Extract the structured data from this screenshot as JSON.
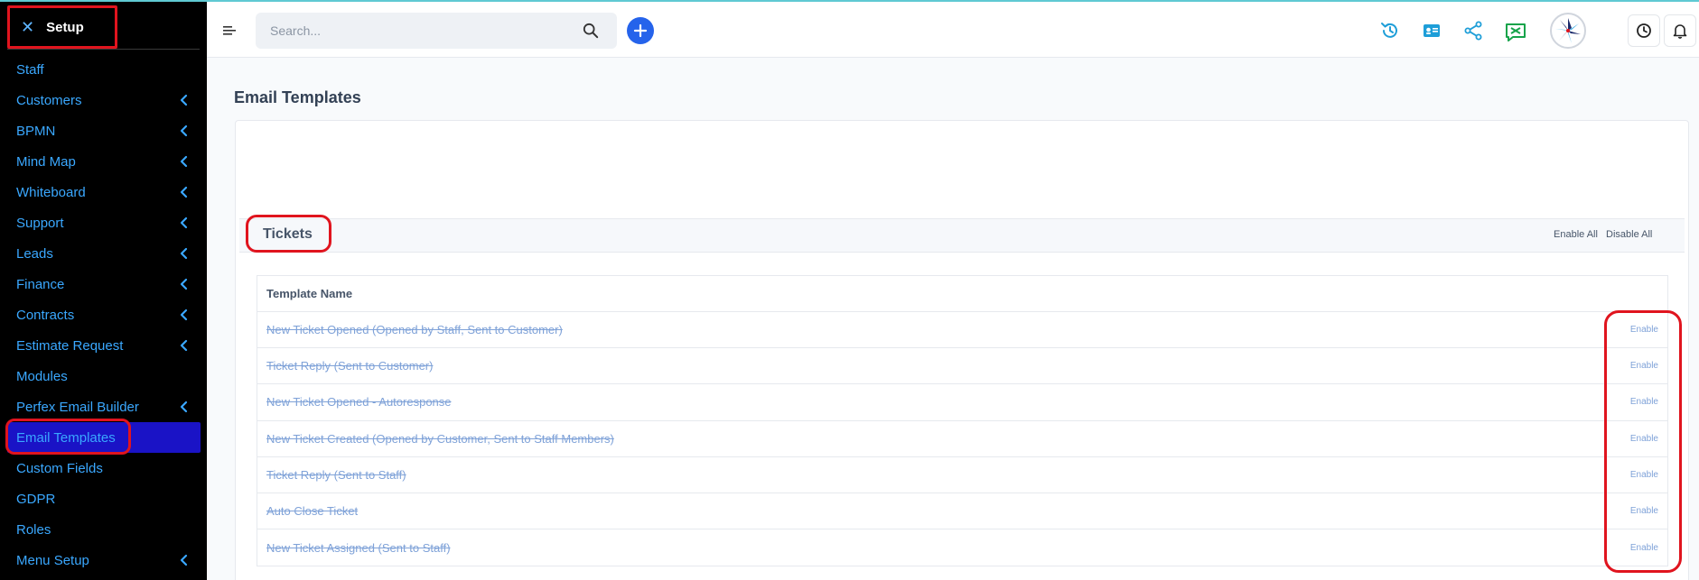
{
  "sidebar": {
    "header": "Setup",
    "items": [
      {
        "label": "Staff",
        "chevron": false
      },
      {
        "label": "Customers",
        "chevron": true
      },
      {
        "label": "BPMN",
        "chevron": true
      },
      {
        "label": "Mind Map",
        "chevron": true
      },
      {
        "label": "Whiteboard",
        "chevron": true
      },
      {
        "label": "Support",
        "chevron": true
      },
      {
        "label": "Leads",
        "chevron": true
      },
      {
        "label": "Finance",
        "chevron": true
      },
      {
        "label": "Contracts",
        "chevron": true
      },
      {
        "label": "Estimate Request",
        "chevron": true
      },
      {
        "label": "Modules",
        "chevron": false
      },
      {
        "label": "Perfex Email Builder",
        "chevron": true
      },
      {
        "label": "Email Templates",
        "chevron": false,
        "active": true
      },
      {
        "label": "Custom Fields",
        "chevron": false
      },
      {
        "label": "GDPR",
        "chevron": false
      },
      {
        "label": "Roles",
        "chevron": false
      },
      {
        "label": "Menu Setup",
        "chevron": true
      }
    ]
  },
  "topbar": {
    "search_placeholder": "Search...",
    "icons": [
      "activity-log-icon",
      "contact-card-icon",
      "share-icon",
      "chat-icon",
      "avatar",
      "clock-icon",
      "bell-icon"
    ]
  },
  "main": {
    "page_title": "Email Templates",
    "section": {
      "title": "Tickets",
      "enable_all": "Enable All",
      "disable_all": "Disable All"
    },
    "table": {
      "header": "Template Name",
      "rows": [
        {
          "name": "New Ticket Opened (Opened by Staff, Sent to Customer)",
          "action": "Enable"
        },
        {
          "name": "Ticket Reply (Sent to Customer)",
          "action": "Enable"
        },
        {
          "name": "New Ticket Opened - Autoresponse",
          "action": "Enable"
        },
        {
          "name": "New Ticket Created (Opened by Customer, Sent to Staff Members)",
          "action": "Enable"
        },
        {
          "name": "Ticket Reply (Sent to Staff)",
          "action": "Enable"
        },
        {
          "name": "Auto Close Ticket",
          "action": "Enable"
        },
        {
          "name": "New Ticket Assigned (Sent to Staff)",
          "action": "Enable"
        }
      ]
    }
  },
  "colors": {
    "sidebar_bg": "#000000",
    "sidebar_link": "#3aa8ff",
    "active_bg": "#1a13c6",
    "highlight_ring": "#e0141e",
    "primary": "#2563eb",
    "accent_teal": "#5fc9d3"
  }
}
